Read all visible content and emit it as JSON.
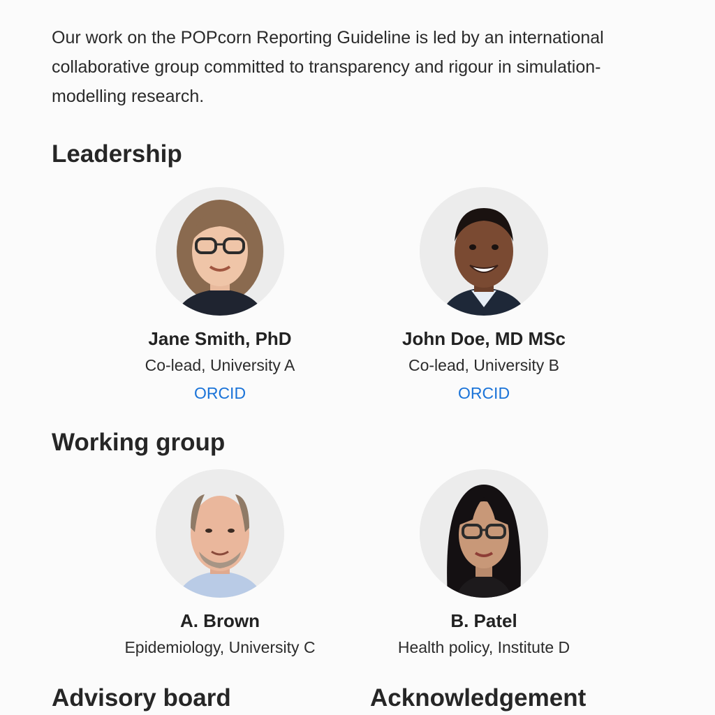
{
  "intro": "Our work on the POPcorn Reporting Guideline is led by an international collaborative group committed to transparency and rigour in simulation-modelling research.",
  "sections": {
    "leadership": "Leadership",
    "working_group": "Working group",
    "advisory_board": "Advisory board",
    "acknowledgement": "Acknowledgement"
  },
  "leadership": [
    {
      "name": "Jane Smith, PhD",
      "role": "Co-lead, University A",
      "link": "ORCID"
    },
    {
      "name": "John Doe, MD MSc",
      "role": "Co-lead, University B",
      "link": "ORCID"
    }
  ],
  "working_group": [
    {
      "name": "A. Brown",
      "role": "Epidemiology, University C"
    },
    {
      "name": "B. Patel",
      "role": "Health policy, Institute D"
    }
  ],
  "colors": {
    "link": "#1a73d8",
    "background": "#fbfbfb",
    "text": "#1f1f1f"
  }
}
